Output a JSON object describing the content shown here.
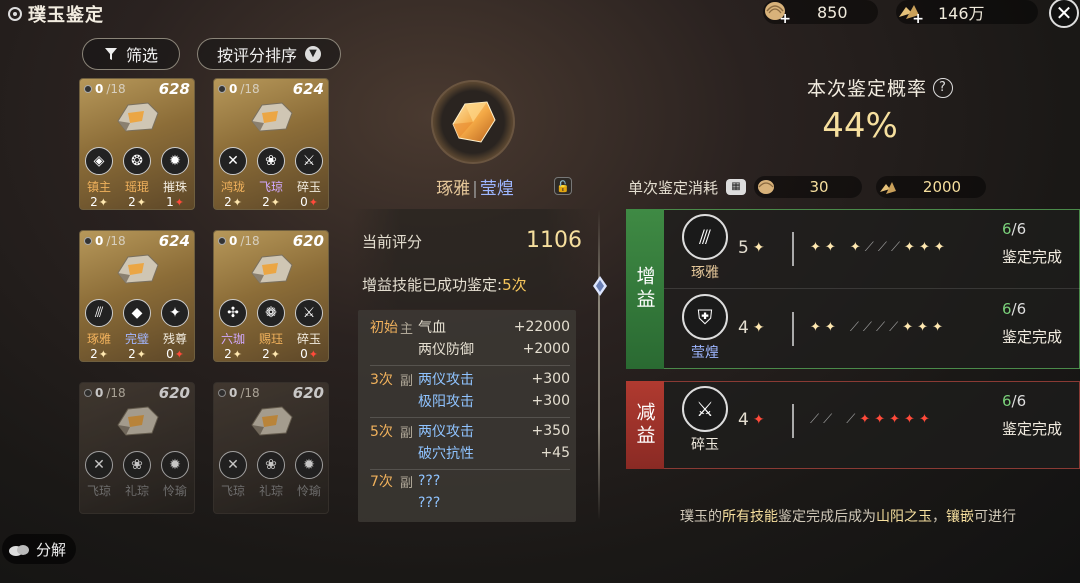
{
  "header": {
    "title": "璞玉鉴定",
    "currency1": "850",
    "currency2": "146万"
  },
  "controls": {
    "filter_label": "筛选",
    "sort_label": "按评分排序"
  },
  "cards": [
    {
      "progress_done": "0",
      "progress_total": "/18",
      "score": "628",
      "style": "gold",
      "skills": [
        {
          "name": "镇主",
          "lv": "2",
          "star": "w",
          "color": "c-orange",
          "glyph": "◈"
        },
        {
          "name": "瑶琨",
          "lv": "2",
          "star": "w",
          "color": "c-orange",
          "glyph": "❂"
        },
        {
          "name": "摧珠",
          "lv": "1",
          "star": "r",
          "color": "c-white",
          "glyph": "✹"
        }
      ]
    },
    {
      "progress_done": "0",
      "progress_total": "/18",
      "score": "624",
      "style": "gold",
      "skills": [
        {
          "name": "鸿珑",
          "lv": "2",
          "star": "w",
          "color": "c-orange",
          "glyph": "✕"
        },
        {
          "name": "飞琼",
          "lv": "2",
          "star": "w",
          "color": "c-purple",
          "glyph": "❀"
        },
        {
          "name": "碎玉",
          "lv": "0",
          "star": "r",
          "color": "c-white",
          "glyph": "⚔"
        }
      ]
    },
    {
      "progress_done": "0",
      "progress_total": "/18",
      "score": "624",
      "style": "gold",
      "skills": [
        {
          "name": "琢雅",
          "lv": "2",
          "star": "w",
          "color": "c-orange",
          "glyph": "⫻"
        },
        {
          "name": "完璧",
          "lv": "2",
          "star": "w",
          "color": "c-blue",
          "glyph": "◆"
        },
        {
          "name": "残尊",
          "lv": "0",
          "star": "r",
          "color": "c-white",
          "glyph": "✦"
        }
      ]
    },
    {
      "progress_done": "0",
      "progress_total": "/18",
      "score": "620",
      "style": "gold",
      "skills": [
        {
          "name": "六珈",
          "lv": "2",
          "star": "w",
          "color": "c-purple",
          "glyph": "✣"
        },
        {
          "name": "赐珏",
          "lv": "2",
          "star": "w",
          "color": "c-orange",
          "glyph": "❁"
        },
        {
          "name": "碎玉",
          "lv": "0",
          "star": "r",
          "color": "c-white",
          "glyph": "⚔"
        }
      ]
    },
    {
      "progress_done": "0",
      "progress_total": "/18",
      "score": "620",
      "style": "dim",
      "skills": [
        {
          "name": "飞琼",
          "lv": "",
          "star": "",
          "color": "c-grey",
          "glyph": "✕"
        },
        {
          "name": "礼琮",
          "lv": "",
          "star": "",
          "color": "c-grey",
          "glyph": "❀"
        },
        {
          "name": "怜瑜",
          "lv": "",
          "star": "",
          "color": "c-grey",
          "glyph": "✹"
        }
      ]
    },
    {
      "progress_done": "0",
      "progress_total": "/18",
      "score": "620",
      "style": "dim",
      "skills": [
        {
          "name": "飞琼",
          "lv": "",
          "star": "",
          "color": "c-grey",
          "glyph": "✕"
        },
        {
          "name": "礼琮",
          "lv": "",
          "star": "",
          "color": "c-grey",
          "glyph": "❀"
        },
        {
          "name": "怜瑜",
          "lv": "",
          "star": "",
          "color": "c-grey",
          "glyph": "✹"
        }
      ]
    }
  ],
  "decompose_label": "分解",
  "jade": {
    "name1": "琢雅",
    "sep": "|",
    "name2": "莹煌",
    "score_label": "当前评分",
    "score_value": "1106",
    "success_prefix": "增益技能已成功鉴定:",
    "success_count": "5次"
  },
  "attributes": [
    {
      "lines": [
        {
          "lv": "初始",
          "tag": "主",
          "name": "气血",
          "val": "+22000",
          "name_color": "#e4ded0"
        },
        {
          "lv": "",
          "tag": "",
          "name": "两仪防御",
          "val": "+2000",
          "name_color": "#e4ded0"
        }
      ]
    },
    {
      "lines": [
        {
          "lv": "3次",
          "tag": "副",
          "name": "两仪攻击",
          "val": "+300",
          "name_color": "#8fc3ff"
        },
        {
          "lv": "",
          "tag": "",
          "name": "极阳攻击",
          "val": "+300",
          "name_color": "#8fc3ff"
        }
      ]
    },
    {
      "lines": [
        {
          "lv": "5次",
          "tag": "副",
          "name": "两仪攻击",
          "val": "+350",
          "name_color": "#8fc3ff"
        },
        {
          "lv": "",
          "tag": "",
          "name": "破穴抗性",
          "val": "+45",
          "name_color": "#8fc3ff"
        }
      ]
    },
    {
      "lines": [
        {
          "lv": "7次",
          "tag": "副",
          "name": "???",
          "val": "",
          "name_color": "#8fc3ff"
        },
        {
          "lv": "",
          "tag": "",
          "name": "???",
          "val": "",
          "name_color": "#8fc3ff"
        }
      ]
    }
  ],
  "right": {
    "prob_title": "本次鉴定概率",
    "prob_value": "44%",
    "cost_label": "单次鉴定消耗",
    "cost1": "30",
    "cost2": "2000",
    "buff_label": "增益",
    "debuff_label": "减益",
    "idents": [
      {
        "name": "琢雅",
        "lv": "5",
        "track": [
          "w",
          "w",
          "|",
          "w",
          "g",
          "g",
          "g",
          "w",
          "w",
          "w"
        ],
        "count": "6",
        "total": "/6",
        "status": "鉴定完成",
        "name_color": "#e6c89a",
        "star": "w",
        "glyph": "⫻"
      },
      {
        "name": "莹煌",
        "lv": "4",
        "track": [
          "w",
          "w",
          "|",
          "g",
          "g",
          "g",
          "g",
          "w",
          "w",
          "w"
        ],
        "count": "6",
        "total": "/6",
        "status": "鉴定完成",
        "name_color": "#9db6ff",
        "star": "w",
        "glyph": "⛨"
      },
      {
        "name": "碎玉",
        "lv": "4",
        "track": [
          "g",
          "g",
          "|",
          "g",
          "r",
          "r",
          "r",
          "r",
          "r"
        ],
        "count": "6",
        "total": "/6",
        "status": "鉴定完成",
        "name_color": "#f2ece0",
        "star": "r",
        "glyph": "⚔"
      }
    ],
    "footer": {
      "p1": "璞玉的",
      "p2": "所有技能",
      "p3": "鉴定完成后成为",
      "p4": "山阳之玉",
      "p5": "，",
      "p6": "镶嵌",
      "p7": "可进行"
    }
  }
}
